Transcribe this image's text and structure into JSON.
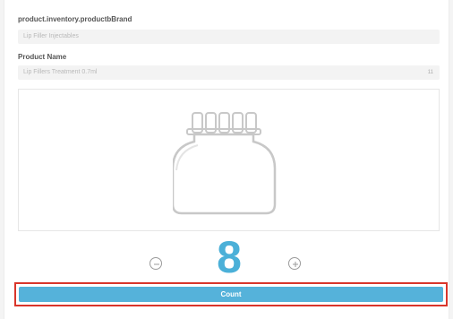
{
  "brand": {
    "label": "product.inventory.productbBrand",
    "value": "Lip Filler Injectables"
  },
  "product": {
    "label": "Product Name",
    "value": "Lip Fillers Treatment 0.7ml",
    "char_count": "11"
  },
  "product_image": {
    "icon": "bottle-icon"
  },
  "quantity": {
    "value": "8",
    "decrement_icon": "minus-circle-icon",
    "increment_icon": "plus-circle-icon"
  },
  "actions": {
    "count_label": "Count"
  },
  "colors": {
    "accent": "#55b2da",
    "quantity": "#4bb0d8",
    "highlight_border": "#d9352a"
  }
}
